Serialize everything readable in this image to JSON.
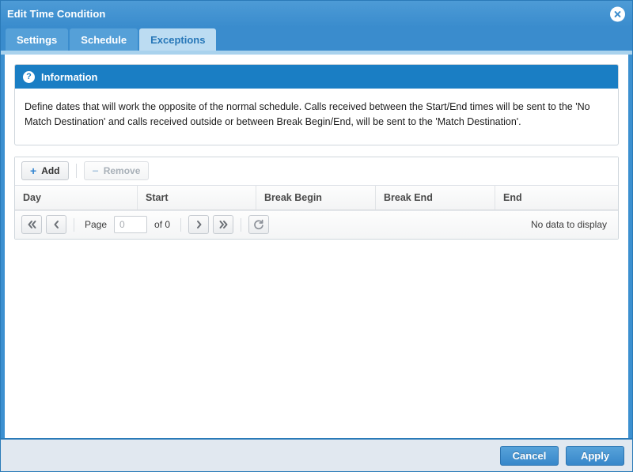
{
  "window": {
    "title": "Edit Time Condition",
    "close_icon": "close-icon"
  },
  "tabs": [
    {
      "label": "Settings",
      "active": false
    },
    {
      "label": "Schedule",
      "active": false
    },
    {
      "label": "Exceptions",
      "active": true
    }
  ],
  "info": {
    "icon": "question-mark-icon",
    "title": "Information",
    "body": "Define dates that will work the opposite of the normal schedule. Calls received between the Start/End times will be sent to the 'No Match Destination' and calls received outside or between Break Begin/End, will be sent to the 'Match Destination'."
  },
  "grid": {
    "toolbar": {
      "add_label": "Add",
      "add_sign": "+",
      "remove_label": "Remove",
      "remove_sign": "−"
    },
    "columns": [
      "Day",
      "Start",
      "Break Begin",
      "Break End",
      "End"
    ],
    "rows": [],
    "pager": {
      "first_icon": "«",
      "prev_icon": "‹",
      "page_label": "Page",
      "page_value": "0",
      "of_label": "of 0",
      "next_icon": "›",
      "last_icon": "»",
      "refresh_icon": "⟳",
      "status": "No data to display"
    }
  },
  "footer": {
    "cancel_label": "Cancel",
    "apply_label": "Apply"
  },
  "colors": {
    "chrome_blue": "#3a8ccd",
    "active_tab_bg": "#bcdcf2",
    "active_tab_text": "#2777b8",
    "info_header_bg": "#1a7ec4",
    "footer_bg": "#e1e8f0",
    "accent_plus": "#2f83d0"
  }
}
